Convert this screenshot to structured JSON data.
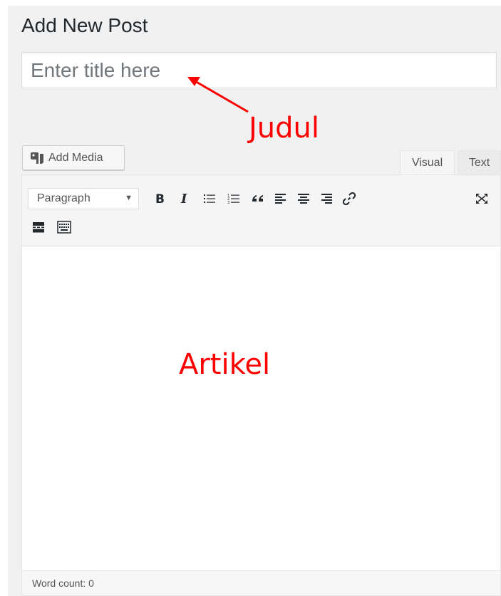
{
  "page": {
    "title": "Add New Post"
  },
  "title_field": {
    "placeholder": "Enter title here",
    "value": ""
  },
  "annotations": {
    "title_label": "Judul",
    "content_label": "Artikel",
    "color": "#ff0000"
  },
  "media_button": {
    "label": "Add Media",
    "icon": "media-icon"
  },
  "tabs": [
    {
      "label": "Visual",
      "active": true
    },
    {
      "label": "Text",
      "active": false
    }
  ],
  "toolbar": {
    "format_select": {
      "selected": "Paragraph"
    },
    "buttons": [
      {
        "name": "bold-icon"
      },
      {
        "name": "italic-icon"
      },
      {
        "name": "bulleted-list-icon"
      },
      {
        "name": "numbered-list-icon"
      },
      {
        "name": "blockquote-icon"
      },
      {
        "name": "align-left-icon"
      },
      {
        "name": "align-center-icon"
      },
      {
        "name": "align-right-icon"
      },
      {
        "name": "insert-link-icon"
      },
      {
        "name": "fullscreen-icon"
      },
      {
        "name": "read-more-icon"
      },
      {
        "name": "toolbar-toggle-icon"
      }
    ]
  },
  "status": {
    "word_count": "Word count: 0"
  }
}
